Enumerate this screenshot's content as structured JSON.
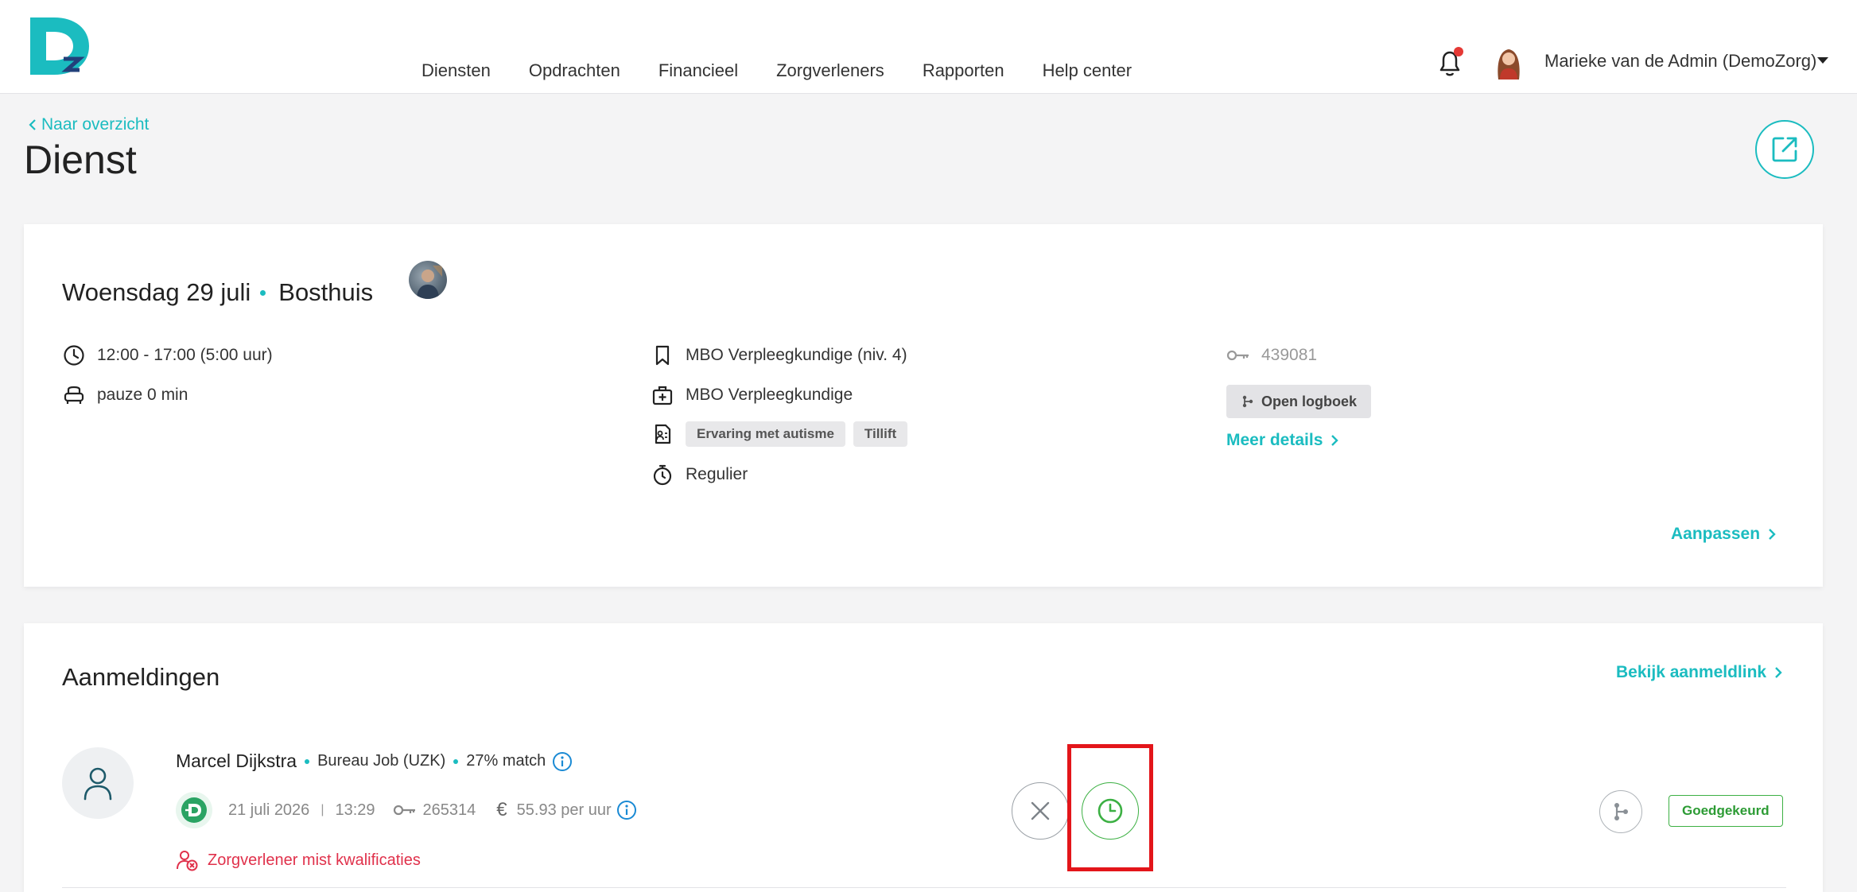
{
  "nav": {
    "items": [
      "Diensten",
      "Opdrachten",
      "Financieel",
      "Zorgverleners",
      "Rapporten",
      "Help center"
    ]
  },
  "user": {
    "name": "Marieke van de Admin (DemoZorg)"
  },
  "colors": {
    "accent": "#1bbcc0",
    "success": "#3cb043",
    "danger": "#e0314b",
    "highlight": "#e3151a"
  },
  "page": {
    "back_label": "Naar overzicht",
    "title": "Dienst"
  },
  "shift": {
    "date": "Woensdag 29 juli",
    "location": "Bosthuis",
    "time": "12:00 - 17:00 (5:00 uur)",
    "pause": "pauze 0 min",
    "function": "MBO Verpleegkundige (niv. 4)",
    "qualification": "MBO Verpleegkundige",
    "tags": [
      "Ervaring met autisme",
      "Tillift"
    ],
    "type": "Regulier",
    "id": "439081",
    "logbook_label": "Open logboek",
    "more_details_label": "Meer details",
    "edit_label": "Aanpassen"
  },
  "applications": {
    "title": "Aanmeldingen",
    "link_label": "Bekijk aanmeldlink",
    "items": [
      {
        "name": "Marcel Dijkstra",
        "agency": "Bureau Job (UZK)",
        "match": "27% match",
        "date": "21 juli 2026",
        "time": "13:29",
        "id": "265314",
        "currency": "€",
        "rate": "55.93 per uur",
        "warning": "Zorgverlener mist kwalificaties",
        "status": "Goedgekeurd"
      }
    ]
  }
}
